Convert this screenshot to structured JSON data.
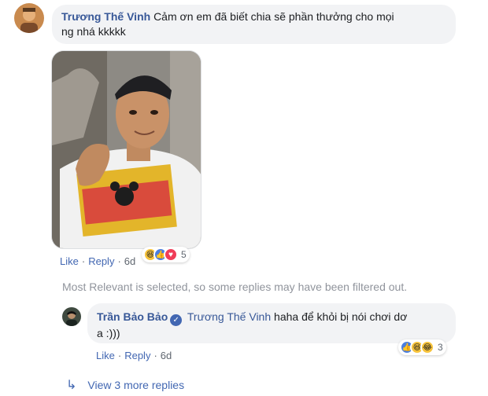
{
  "comment": {
    "author": "Trương Thế Vinh",
    "text_line1": "Cảm ơn em đã biết chia sẽ phần thưởng cho mọi",
    "text_line2": "ng nhá kkkkk",
    "actions": {
      "like": "Like",
      "reply": "Reply",
      "time": "6d"
    },
    "reactions": {
      "icons": [
        "haha-icon",
        "like-icon",
        "love-icon"
      ],
      "count": "5"
    }
  },
  "filter_notice": "Most Relevant is selected, so some replies may have been filtered out.",
  "reply": {
    "author": "Trần Bảo Bảo",
    "mention": "Trương Thế Vinh",
    "text_line1": "haha để khỏi bị nói chơi dơ",
    "text_line2": "a :)))",
    "actions": {
      "like": "Like",
      "reply": "Reply",
      "time": "6d"
    },
    "reactions": {
      "icons": [
        "like-icon",
        "haha-icon",
        "haha-icon"
      ],
      "count": "3"
    }
  },
  "view_more": "View 3 more replies",
  "colors": {
    "link": "#385898",
    "action": "#4267b2",
    "bubble": "#f2f3f5",
    "muted": "#90949c"
  }
}
